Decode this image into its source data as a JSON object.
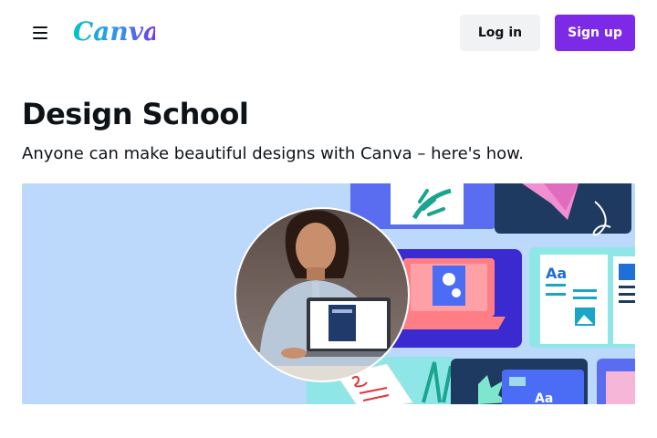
{
  "header": {
    "logo_text": "Canva",
    "login_label": "Log in",
    "signup_label": "Sign up"
  },
  "main": {
    "title": "Design School",
    "subtitle": "Anyone can make beautiful designs with Canva – here's how."
  },
  "hero": {
    "card_text": "Aa",
    "card_text_2": "Aa"
  },
  "icons": {
    "menu": "hamburger-menu-icon"
  },
  "colors": {
    "brand_purple": "#7d2ae8",
    "logo_teal": "#00c4cc",
    "hero_background": "#bcd8fa"
  }
}
